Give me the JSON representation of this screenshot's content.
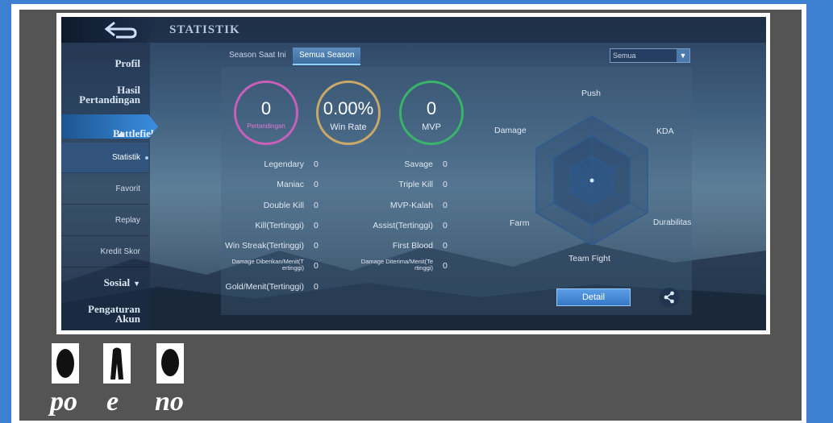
{
  "header": {
    "title": "STATISTIK"
  },
  "sidebar": {
    "profil": "Profil",
    "hasil_line1": "Hasil",
    "hasil_line2": "Pertandingan",
    "battlefield": "Battlefield",
    "sub_items": [
      "Statistik",
      "Favorit",
      "Replay",
      "Kredit Skor"
    ],
    "sosial": "Sosial",
    "pengaturan_line1": "Pengaturan",
    "pengaturan_line2": "Akun"
  },
  "tabs": [
    "Season Saat Ini",
    "Semua Season"
  ],
  "filter": {
    "selected": "Semua"
  },
  "summary": {
    "pertandingan": {
      "value": "0",
      "label": "Pertandingan",
      "color": "#c85fb8"
    },
    "win_rate": {
      "value": "0.00%",
      "label": "Win Rate",
      "color": "#c9a86a"
    },
    "mvp": {
      "value": "0",
      "label": "MVP",
      "color": "#39b46a"
    }
  },
  "stats_left": [
    {
      "label": "Legendary",
      "value": "0"
    },
    {
      "label": "Maniac",
      "value": "0"
    },
    {
      "label": "Double Kill",
      "value": "0"
    },
    {
      "label": "Kill(Tertinggi)",
      "value": "0"
    },
    {
      "label": "Win Streak(Tertinggi)",
      "value": "0"
    },
    {
      "label_line1": "Damage Diberikan/Menit(T",
      "label_line2": "ertinggi)",
      "value": "0"
    },
    {
      "label": "Gold/Menit(Tertinggi)",
      "value": "0"
    }
  ],
  "stats_right": [
    {
      "label": "Savage",
      "value": "0"
    },
    {
      "label": "Triple Kill",
      "value": "0"
    },
    {
      "label": "MVP-Kalah",
      "value": "0"
    },
    {
      "label": "Assist(Tertinggi)",
      "value": "0"
    },
    {
      "label": "First Blood",
      "value": "0"
    },
    {
      "label_line1": "Damage Diterima/Menit(Te",
      "label_line2": "rtinggi)",
      "value": "0"
    }
  ],
  "radar": {
    "labels": {
      "push": "Push",
      "kda": "KDA",
      "durabilitas": "Durabilitas",
      "team_fight": "Team Fight",
      "farm": "Farm",
      "damage": "Damage"
    }
  },
  "buttons": {
    "detail": "Detail"
  },
  "icons": {
    "back": "back-arrow-icon",
    "share": "share-icon",
    "chevron": "chevron-down-icon"
  },
  "bottom": {
    "texts": [
      "po",
      "e",
      "no"
    ]
  }
}
